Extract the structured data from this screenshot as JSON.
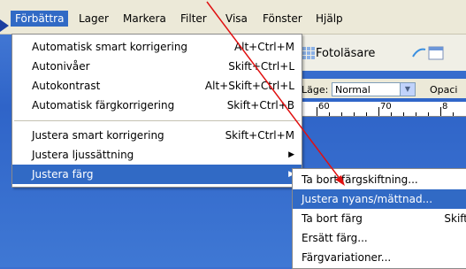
{
  "menubar": {
    "items": [
      {
        "label": "Förbättra"
      },
      {
        "label": "Lager"
      },
      {
        "label": "Markera"
      },
      {
        "label": "Filter"
      },
      {
        "label": "Visa"
      },
      {
        "label": "Fönster"
      },
      {
        "label": "Hjälp"
      }
    ]
  },
  "toolbar": {
    "fotolasare": "Fotoläsare"
  },
  "options": {
    "lage_label": "Läge:",
    "lage_value": "Normal",
    "opacity_label": "Opaci"
  },
  "ruler": {
    "labels": [
      "60",
      "70",
      "8"
    ]
  },
  "enhance_menu": {
    "items": [
      {
        "label": "Automatisk smart korrigering",
        "shortcut": "Alt+Ctrl+M"
      },
      {
        "label": "Autonivåer",
        "shortcut": "Skift+Ctrl+L"
      },
      {
        "label": "Autokontrast",
        "shortcut": "Alt+Skift+Ctrl+L"
      },
      {
        "label": "Automatisk färgkorrigering",
        "shortcut": "Skift+Ctrl+B"
      },
      {
        "label": "Justera smart korrigering",
        "shortcut": "Skift+Ctrl+M"
      },
      {
        "label": "Justera ljussättning",
        "shortcut": ""
      },
      {
        "label": "Justera färg",
        "shortcut": ""
      }
    ]
  },
  "color_submenu": {
    "items": [
      {
        "label": "Ta bort färgskiftning..."
      },
      {
        "label": "Justera nyans/mättnad..."
      },
      {
        "label": "Ta bort färg",
        "shortcut": "Skift"
      },
      {
        "label": "Ersätt färg..."
      },
      {
        "label": "Färgvariationer..."
      }
    ]
  },
  "colors": {
    "highlight": "#316ac5",
    "annotation_red": "#e01010"
  }
}
